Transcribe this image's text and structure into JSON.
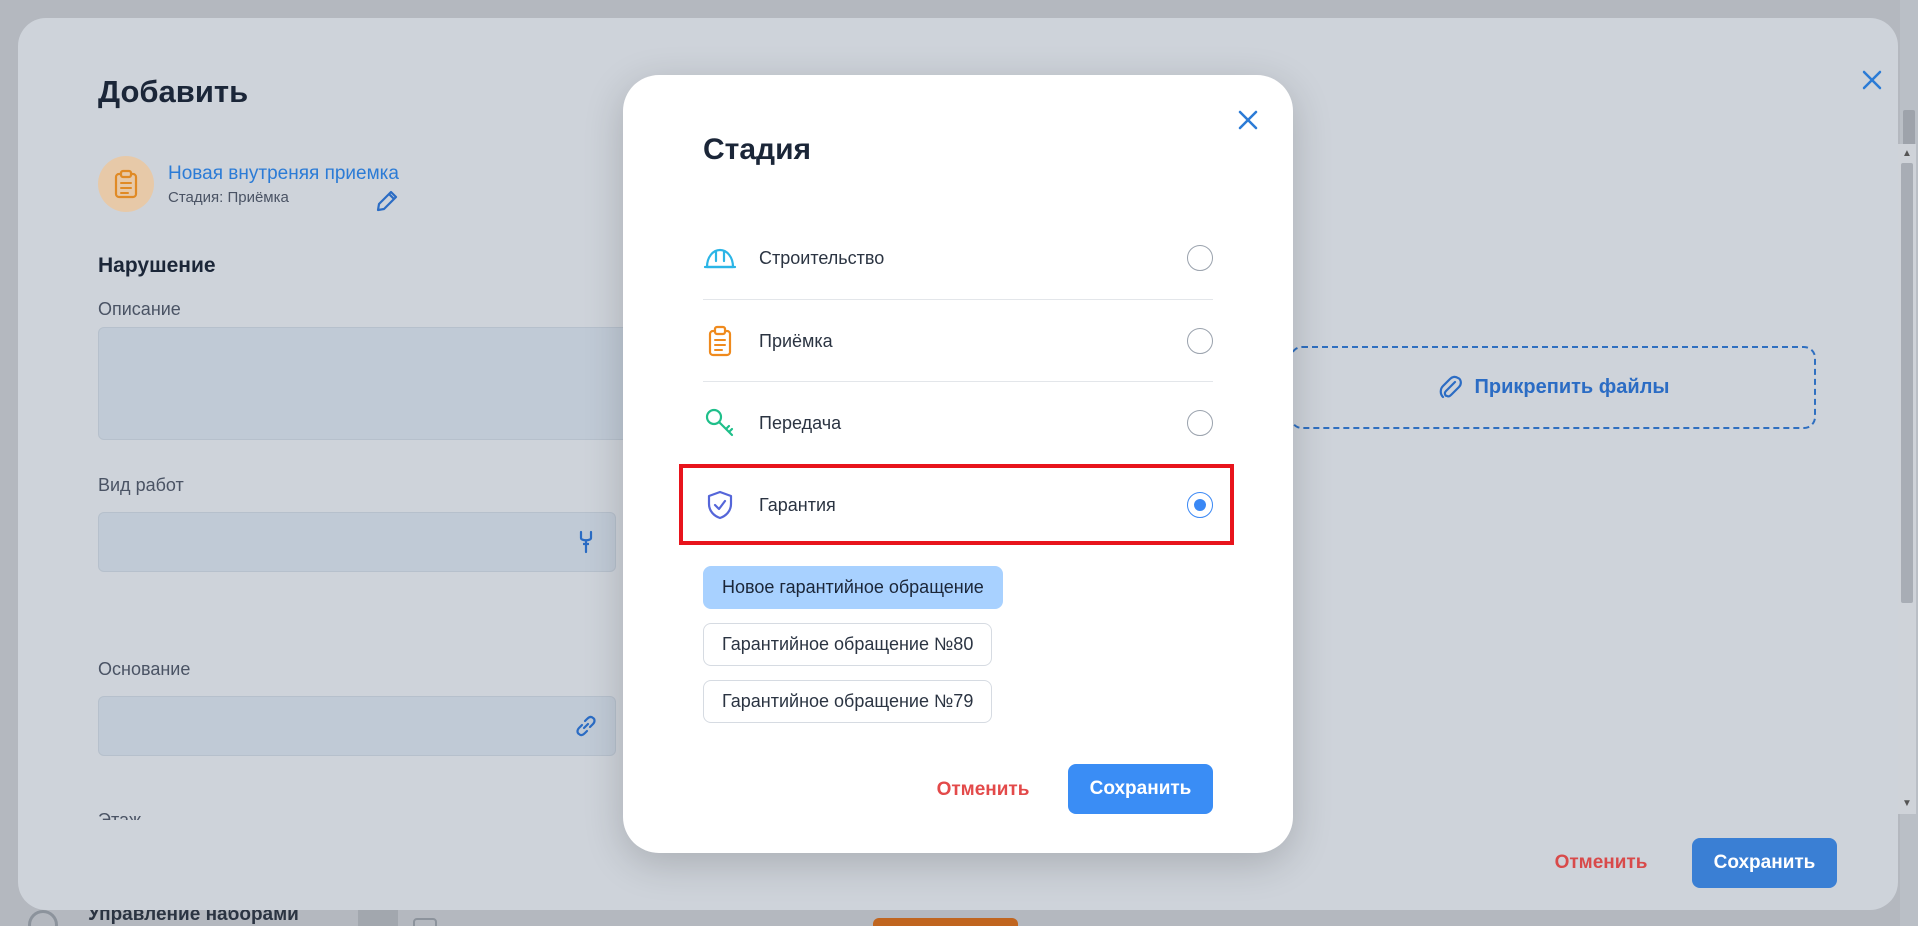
{
  "background": {
    "bottom_label": "Управление наборами"
  },
  "main_modal": {
    "title": "Добавить",
    "entity": {
      "name": "Новая внутреняя приемка",
      "stage": "Стадия: Приёмка"
    },
    "section_title": "Нарушение",
    "fields": {
      "description_label": "Описание",
      "work_type_label": "Вид работ",
      "basis_label": "Основание",
      "floor_label": "Этаж"
    },
    "attach_label": "Прикрепить файлы",
    "cancel_label": "Отменить",
    "save_label": "Сохранить"
  },
  "dialog": {
    "title": "Стадия",
    "options": [
      {
        "label": "Строительство",
        "icon": "helmet-icon",
        "color": "#2bb5e6",
        "selected": false
      },
      {
        "label": "Приёмка",
        "icon": "clipboard-icon",
        "color": "#ef8a1d",
        "selected": false
      },
      {
        "label": "Передача",
        "icon": "key-icon",
        "color": "#1fbf8a",
        "selected": false
      },
      {
        "label": "Гарантия",
        "icon": "shield-check-icon",
        "color": "#5566d9",
        "selected": true
      }
    ],
    "chips": [
      {
        "label": "Новое гарантийное обращение",
        "active": true
      },
      {
        "label": "Гарантийное обращение №80",
        "active": false
      },
      {
        "label": "Гарантийное обращение №79",
        "active": false
      }
    ],
    "cancel_label": "Отменить",
    "save_label": "Сохранить"
  },
  "colors": {
    "accent": "#3a8df5",
    "danger": "#e34a4a",
    "highlight": "#e8141c"
  }
}
